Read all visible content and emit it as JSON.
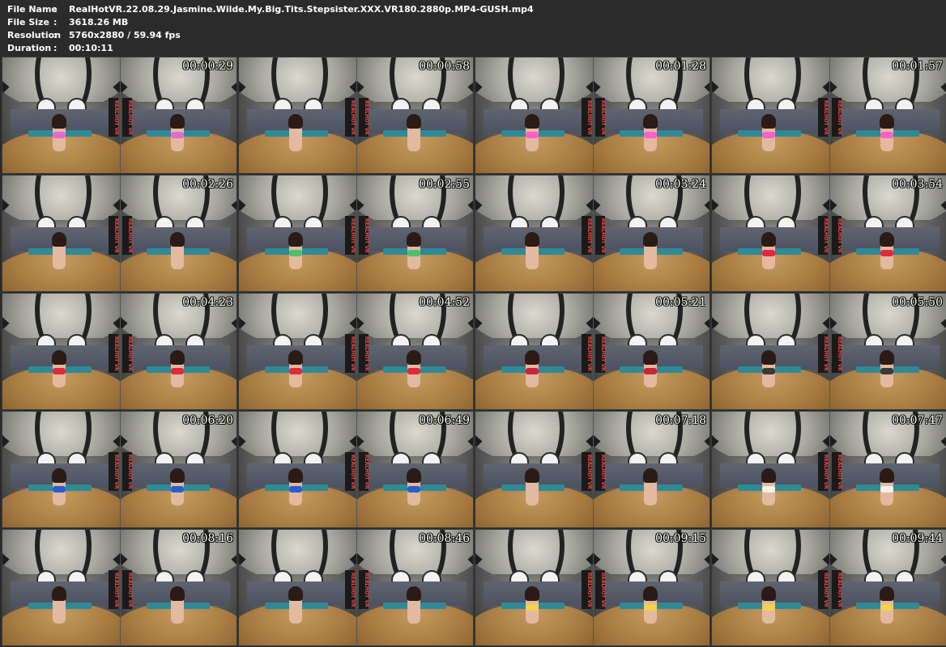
{
  "info": [
    {
      "label": "File Name",
      "value": "RealHotVR.22.08.29.Jasmine.Wilde.My.Big.Tits.Stepsister.XXX.VR180.2880p.MP4-GUSH.mp4"
    },
    {
      "label": "File Size",
      "value": "3618.26 MB"
    },
    {
      "label": "Resolution",
      "value": "5760x2880 / 59.94 fps"
    },
    {
      "label": "Duration",
      "value": "00:10:11"
    }
  ],
  "separator": ":",
  "watermark": "REALHOT VR",
  "thumbnails": [
    {
      "timestamp": "00:00:29",
      "garment_color": "#e26ad0"
    },
    {
      "timestamp": "00:00:58",
      "garment_color": "#e3b9a0"
    },
    {
      "timestamp": "00:01:28",
      "garment_color": "#ff5fc8"
    },
    {
      "timestamp": "00:01:57",
      "garment_color": "#ff5fc8"
    },
    {
      "timestamp": "00:02:26",
      "garment_color": "#e3b9a0"
    },
    {
      "timestamp": "00:02:55",
      "garment_color": "#4fc06a"
    },
    {
      "timestamp": "00:03:24",
      "garment_color": "#e3b9a0"
    },
    {
      "timestamp": "00:03:54",
      "garment_color": "#e02a3a"
    },
    {
      "timestamp": "00:04:23",
      "garment_color": "#e02a3a"
    },
    {
      "timestamp": "00:04:52",
      "garment_color": "#e02a3a"
    },
    {
      "timestamp": "00:05:21",
      "garment_color": "#c8243a"
    },
    {
      "timestamp": "00:05:50",
      "garment_color": "#3a3a3a"
    },
    {
      "timestamp": "00:06:20",
      "garment_color": "#2a5ed0"
    },
    {
      "timestamp": "00:06:49",
      "garment_color": "#2a5ed0"
    },
    {
      "timestamp": "00:07:18",
      "garment_color": "#e3b9a0"
    },
    {
      "timestamp": "00:07:47",
      "garment_color": "#f4f0e8"
    },
    {
      "timestamp": "00:08:16",
      "garment_color": "#e3b9a0"
    },
    {
      "timestamp": "00:08:46",
      "garment_color": "#e3b9a0"
    },
    {
      "timestamp": "00:09:15",
      "garment_color": "#f2d24a"
    },
    {
      "timestamp": "00:09:44",
      "garment_color": "#f2d24a"
    }
  ]
}
